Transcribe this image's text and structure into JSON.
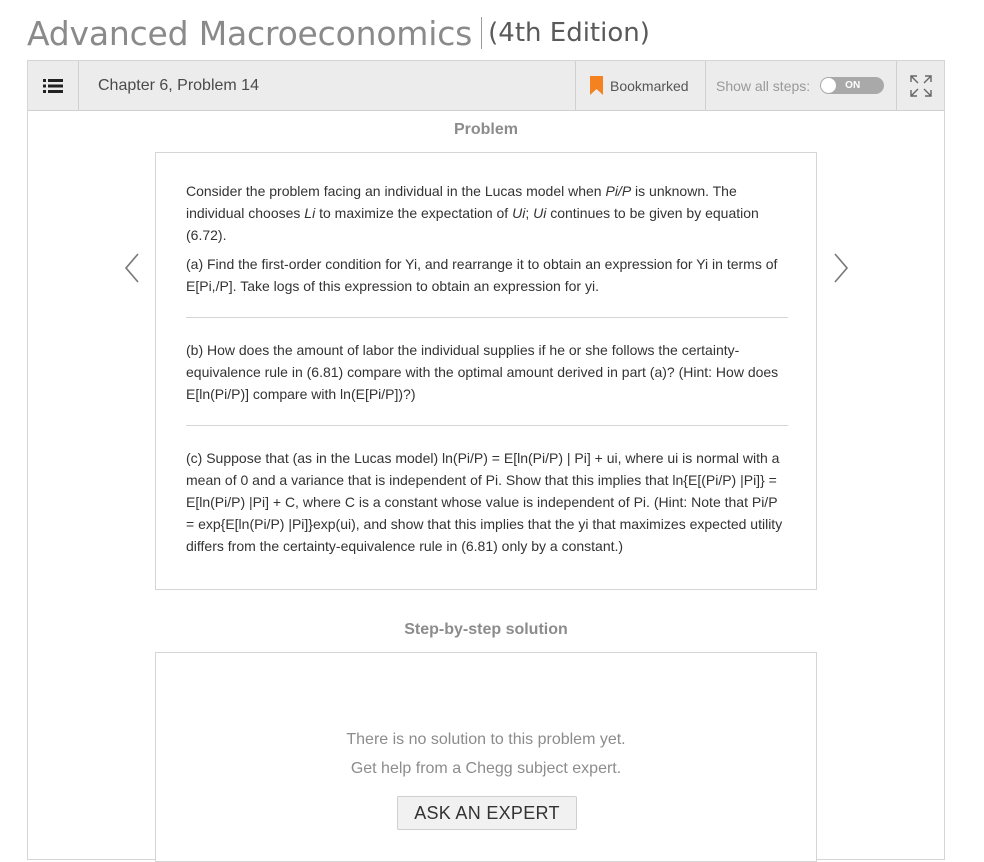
{
  "book": {
    "title": "Advanced Macroeconomics",
    "edition": "(4th Edition)"
  },
  "toolbar": {
    "chapter": "Chapter 6, Problem 14",
    "bookmark_label": "Bookmarked",
    "show_steps_label": "Show all steps:",
    "toggle_state": "ON"
  },
  "problem": {
    "heading": "Problem",
    "intro_1a": "Consider the problem facing an individual in the Lucas model when ",
    "intro_1b": "Pi/P",
    "intro_1c": " is unknown. The individual chooses ",
    "intro_1d": "Li",
    "intro_1e": " to maximize the expectation of ",
    "intro_1f": "Ui",
    "intro_1g": "; ",
    "intro_1h": "Ui",
    "intro_1i": " continues to be given by equation (6.72).",
    "part_a": "(a) Find the first-order condition for Yi, and rearrange it to obtain an expression for Yi in terms of E[Pi,/P]. Take logs of this expression to obtain an expression for yi.",
    "part_b": "(b) How does the amount of labor the individual supplies if he or she follows the certainty-equivalence rule in (6.81) compare with the optimal amount derived in part (a)? (Hint: How does E[ln(Pi/P)] compare with ln(E[Pi/P])?)",
    "part_c": "(c) Suppose that (as in the Lucas model) ln(Pi/P) = E[ln(Pi/P) | Pi] + ui, where ui is normal with a mean of 0 and a variance that is independent of Pi. Show that this implies that ln{E[(Pi/P) |Pi]} = E[ln(Pi/P) |Pi] + C, where C is a constant whose value is independent of Pi. (Hint: Note that Pi/P = exp{E[ln(Pi/P) |Pi]}exp(ui), and show that this implies that the yi that maximizes expected utility differs from the certainty-equivalence rule in (6.81) only by a constant.)"
  },
  "solution": {
    "heading": "Step-by-step solution",
    "line1": "There is no solution to this problem yet.",
    "line2": "Get help from a Chegg subject expert.",
    "ask_button": "ASK AN EXPERT"
  },
  "icons": {
    "menu": "list-icon",
    "bookmark": "bookmark-icon",
    "expand": "expand-icon",
    "prev": "chevron-left-icon",
    "next": "chevron-right-icon"
  },
  "colors": {
    "bookmark": "#f58220",
    "toggle_bg": "#a9a9a9",
    "toolbar_bg": "#ececec"
  }
}
